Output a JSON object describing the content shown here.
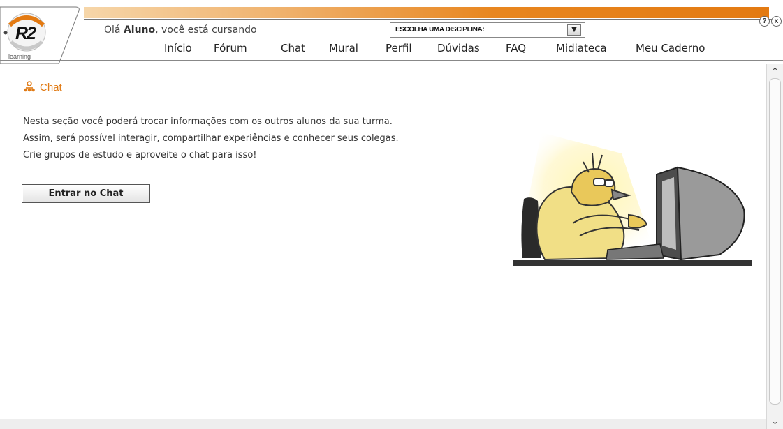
{
  "logo": {
    "brand": "R2",
    "subtitle": "learning"
  },
  "header": {
    "greeting_prefix": "Olá ",
    "user_name": "Aluno",
    "greeting_suffix": ", você está cursando",
    "discipline_select": {
      "selected": "ESCOLHA UMA DISCIPLINA:",
      "arrow_icon": "chevron-down-icon"
    },
    "help_label": "?",
    "close_label": "x"
  },
  "nav": [
    {
      "label": "Início"
    },
    {
      "label": "Fórum"
    },
    {
      "label": "Chat"
    },
    {
      "label": "Mural"
    },
    {
      "label": "Perfil"
    },
    {
      "label": "Dúvidas"
    },
    {
      "label": "FAQ"
    },
    {
      "label": "Midiateca"
    },
    {
      "label": "Meu Caderno"
    }
  ],
  "main": {
    "title": "Chat",
    "title_icon": "people-icon",
    "description": [
      "Nesta seção você poderá trocar informações com os outros alunos da sua turma.",
      "Assim, será possível interagir, compartilhar experiências e conhecer seus colegas.",
      "Crie grupos de estudo e aproveite o chat para isso!"
    ],
    "enter_button": "Entrar no Chat"
  },
  "colors": {
    "accent": "#e07b16",
    "bar_orange": "#e37a12"
  }
}
